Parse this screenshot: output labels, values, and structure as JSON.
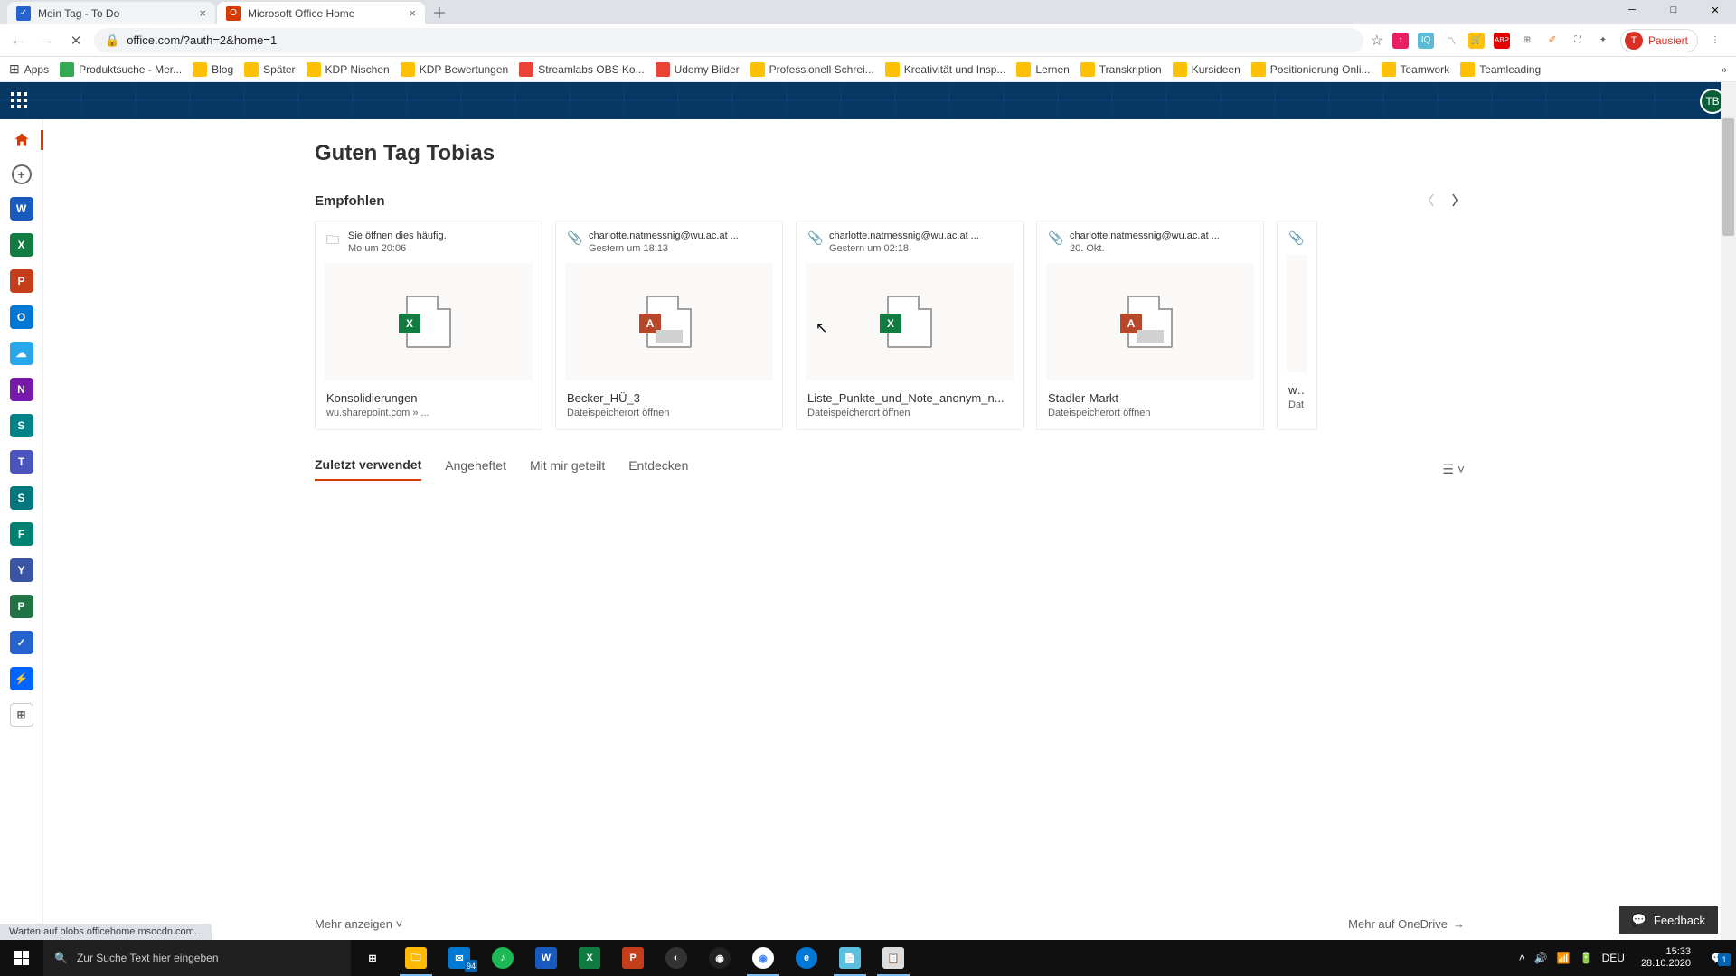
{
  "browser": {
    "tabs": [
      {
        "title": "Mein Tag - To Do",
        "favicon_bg": "#2564cf",
        "favicon_text": "✓"
      },
      {
        "title": "Microsoft Office Home",
        "favicon_bg": "#d83b01",
        "favicon_text": "O"
      }
    ],
    "url": "office.com/?auth=2&home=1",
    "profile_label": "Pausiert",
    "profile_initial": "T",
    "bookmarks": [
      {
        "label": "Apps"
      },
      {
        "label": "Produktsuche - Mer..."
      },
      {
        "label": "Blog"
      },
      {
        "label": "Später"
      },
      {
        "label": "KDP Nischen"
      },
      {
        "label": "KDP Bewertungen"
      },
      {
        "label": "Streamlabs OBS Ko..."
      },
      {
        "label": "Udemy Bilder"
      },
      {
        "label": "Professionell Schrei..."
      },
      {
        "label": "Kreativität und Insp..."
      },
      {
        "label": "Lernen"
      },
      {
        "label": "Transkription"
      },
      {
        "label": "Kursideen"
      },
      {
        "label": "Positionierung Onli..."
      },
      {
        "label": "Teamwork"
      },
      {
        "label": "Teamleading"
      }
    ],
    "status_text": "Warten auf blobs.officehome.msocdn.com..."
  },
  "office": {
    "avatar_initials": "TB",
    "greeting": "Guten Tag Tobias",
    "recommended_label": "Empfohlen",
    "cards": [
      {
        "head_line1": "Sie öffnen dies häufig.",
        "head_line2": "Mo um 20:06",
        "head_icon": "folder",
        "file_type": "excel",
        "title": "Konsolidierungen",
        "subtitle": "wu.sharepoint.com » ..."
      },
      {
        "head_line1": "charlotte.natmessnig@wu.ac.at ...",
        "head_line2": "Gestern um 18:13",
        "head_icon": "attach",
        "file_type": "access",
        "title": "Becker_HÜ_3",
        "subtitle": "Dateispeicherort öffnen"
      },
      {
        "head_line1": "charlotte.natmessnig@wu.ac.at ...",
        "head_line2": "Gestern um 02:18",
        "head_icon": "attach",
        "file_type": "excel",
        "title": "Liste_Punkte_und_Note_anonym_n...",
        "subtitle": "Dateispeicherort öffnen"
      },
      {
        "head_line1": "charlotte.natmessnig@wu.ac.at ...",
        "head_line2": "20. Okt.",
        "head_icon": "attach",
        "file_type": "access",
        "title": "Stadler-Markt",
        "subtitle": "Dateispeicherort öffnen"
      }
    ],
    "partial_card": {
      "title": "ws.",
      "subtitle": "Dat"
    },
    "tabs": {
      "recent": "Zuletzt verwendet",
      "pinned": "Angeheftet",
      "shared": "Mit mir geteilt",
      "discover": "Entdecken"
    },
    "show_more": "Mehr anzeigen",
    "more_onedrive": "Mehr auf OneDrive",
    "feedback": "Feedback"
  },
  "taskbar": {
    "search_placeholder": "Zur Suche Text hier eingeben",
    "mail_badge": "94",
    "lang": "DEU",
    "time": "15:33",
    "date": "28.10.2020",
    "notif_count": "1"
  }
}
